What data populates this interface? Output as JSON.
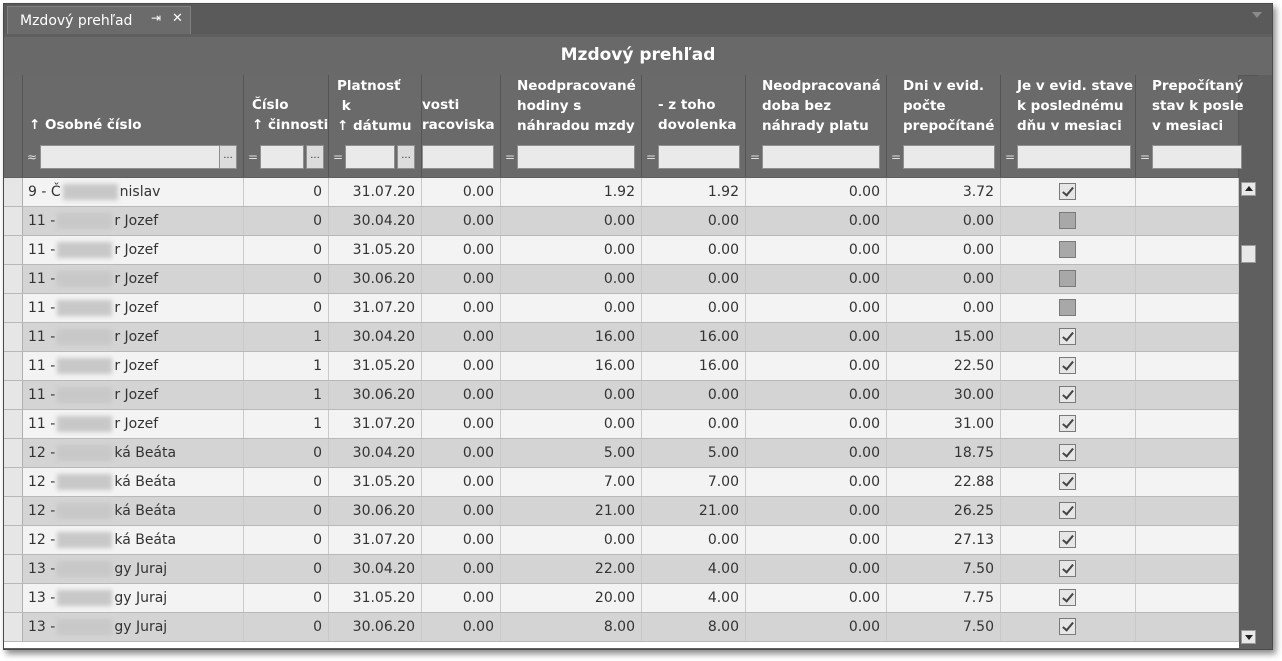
{
  "tab": {
    "title": "Mzdový prehľad",
    "pin": "📌",
    "close": "✕"
  },
  "grid_title": "Mzdový prehľad",
  "columns": [
    {
      "label": "↑ Osobné číslo",
      "filter": "≈"
    },
    {
      "label": "Číslo\n↑ činnosti",
      "filter": "="
    },
    {
      "label": "Platnosť\n k\n↑ dátumu",
      "filter": "="
    },
    {
      "label": "vosti\nracoviska",
      "filter": ""
    },
    {
      "label": "Neodpracované\nhodiny s\nnáhradou mzdy",
      "filter": "="
    },
    {
      "label": "- z toho\ndovolenka",
      "filter": "="
    },
    {
      "label": "Neodpracovaná\ndoba bez\nnáhrady platu",
      "filter": "="
    },
    {
      "label": "Dni v evid.\npočte\nprepočítané",
      "filter": "="
    },
    {
      "label": "Je v evid. stave\nk poslednému\ndňu v mesiaci",
      "filter": "="
    },
    {
      "label": "Prepočítaný\nstav k posle\nv mesiaci",
      "filter": "="
    }
  ],
  "rows": [
    {
      "num": "9 - Č",
      "name": "nislav",
      "cin": "0",
      "date": "31.07.20",
      "prac": "0.00",
      "neod": "1.92",
      "dov": "1.92",
      "bez": "0.00",
      "dni": "3.72",
      "chk": true
    },
    {
      "num": "11 -",
      "name": "r Jozef",
      "cin": "0",
      "date": "30.04.20",
      "prac": "0.00",
      "neod": "0.00",
      "dov": "0.00",
      "bez": "0.00",
      "dni": "0.00",
      "chk": false
    },
    {
      "num": "11 -",
      "name": "r Jozef",
      "cin": "0",
      "date": "31.05.20",
      "prac": "0.00",
      "neod": "0.00",
      "dov": "0.00",
      "bez": "0.00",
      "dni": "0.00",
      "chk": false
    },
    {
      "num": "11 -",
      "name": "r Jozef",
      "cin": "0",
      "date": "30.06.20",
      "prac": "0.00",
      "neod": "0.00",
      "dov": "0.00",
      "bez": "0.00",
      "dni": "0.00",
      "chk": false
    },
    {
      "num": "11 -",
      "name": "r Jozef",
      "cin": "0",
      "date": "31.07.20",
      "prac": "0.00",
      "neod": "0.00",
      "dov": "0.00",
      "bez": "0.00",
      "dni": "0.00",
      "chk": false
    },
    {
      "num": "11 -",
      "name": "r Jozef",
      "cin": "1",
      "date": "30.04.20",
      "prac": "0.00",
      "neod": "16.00",
      "dov": "16.00",
      "bez": "0.00",
      "dni": "15.00",
      "chk": true
    },
    {
      "num": "11 -",
      "name": "r Jozef",
      "cin": "1",
      "date": "31.05.20",
      "prac": "0.00",
      "neod": "16.00",
      "dov": "16.00",
      "bez": "0.00",
      "dni": "22.50",
      "chk": true
    },
    {
      "num": "11 -",
      "name": "r Jozef",
      "cin": "1",
      "date": "30.06.20",
      "prac": "0.00",
      "neod": "0.00",
      "dov": "0.00",
      "bez": "0.00",
      "dni": "30.00",
      "chk": true
    },
    {
      "num": "11 -",
      "name": "r Jozef",
      "cin": "1",
      "date": "31.07.20",
      "prac": "0.00",
      "neod": "0.00",
      "dov": "0.00",
      "bez": "0.00",
      "dni": "31.00",
      "chk": true
    },
    {
      "num": "12 -",
      "name": "ká Beáta",
      "cin": "0",
      "date": "30.04.20",
      "prac": "0.00",
      "neod": "5.00",
      "dov": "5.00",
      "bez": "0.00",
      "dni": "18.75",
      "chk": true
    },
    {
      "num": "12 -",
      "name": "ká Beáta",
      "cin": "0",
      "date": "31.05.20",
      "prac": "0.00",
      "neod": "7.00",
      "dov": "7.00",
      "bez": "0.00",
      "dni": "22.88",
      "chk": true
    },
    {
      "num": "12 -",
      "name": "ká Beáta",
      "cin": "0",
      "date": "30.06.20",
      "prac": "0.00",
      "neod": "21.00",
      "dov": "21.00",
      "bez": "0.00",
      "dni": "26.25",
      "chk": true
    },
    {
      "num": "12 -",
      "name": "ká Beáta",
      "cin": "0",
      "date": "31.07.20",
      "prac": "0.00",
      "neod": "0.00",
      "dov": "0.00",
      "bez": "0.00",
      "dni": "27.13",
      "chk": true
    },
    {
      "num": "13 -",
      "name": "gy Juraj",
      "cin": "0",
      "date": "30.04.20",
      "prac": "0.00",
      "neod": "22.00",
      "dov": "4.00",
      "bez": "0.00",
      "dni": "7.50",
      "chk": true
    },
    {
      "num": "13 -",
      "name": "gy Juraj",
      "cin": "0",
      "date": "31.05.20",
      "prac": "0.00",
      "neod": "20.00",
      "dov": "4.00",
      "bez": "0.00",
      "dni": "7.75",
      "chk": true
    },
    {
      "num": "13 -",
      "name": "gy Juraj",
      "cin": "0",
      "date": "30.06.20",
      "prac": "0.00",
      "neod": "8.00",
      "dov": "8.00",
      "bez": "0.00",
      "dni": "7.50",
      "chk": true
    }
  ]
}
